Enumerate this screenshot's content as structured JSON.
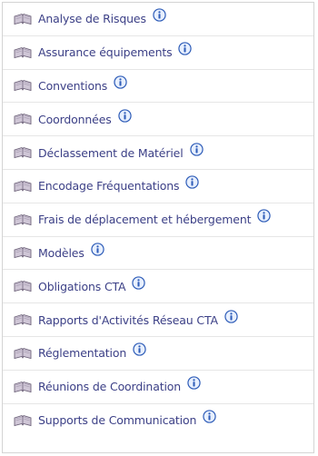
{
  "colors": {
    "link_text": "#3b3f86",
    "info_icon": "#2f5db8",
    "book_icon": "#7a6d86",
    "separator": "#e6e6e6",
    "border": "#d4d4d4"
  },
  "list": {
    "items": [
      {
        "label": "Analyse de Risques",
        "icon": "book-icon",
        "info_icon": "info-icon"
      },
      {
        "label": "Assurance équipements",
        "icon": "book-icon",
        "info_icon": "info-icon"
      },
      {
        "label": "Conventions",
        "icon": "book-icon",
        "info_icon": "info-icon"
      },
      {
        "label": "Coordonnées",
        "icon": "book-icon",
        "info_icon": "info-icon"
      },
      {
        "label": "Déclassement de Matériel",
        "icon": "book-icon",
        "info_icon": "info-icon"
      },
      {
        "label": "Encodage Fréquentations",
        "icon": "book-icon",
        "info_icon": "info-icon"
      },
      {
        "label": "Frais de déplacement et hébergement",
        "icon": "book-icon",
        "info_icon": "info-icon"
      },
      {
        "label": "Modèles",
        "icon": "book-icon",
        "info_icon": "info-icon"
      },
      {
        "label": "Obligations CTA",
        "icon": "book-icon",
        "info_icon": "info-icon"
      },
      {
        "label": "Rapports d'Activités Réseau CTA",
        "icon": "book-icon",
        "info_icon": "info-icon"
      },
      {
        "label": "Réglementation",
        "icon": "book-icon",
        "info_icon": "info-icon"
      },
      {
        "label": "Réunions de Coordination",
        "icon": "book-icon",
        "info_icon": "info-icon"
      },
      {
        "label": "Supports de Communication",
        "icon": "book-icon",
        "info_icon": "info-icon"
      }
    ]
  }
}
